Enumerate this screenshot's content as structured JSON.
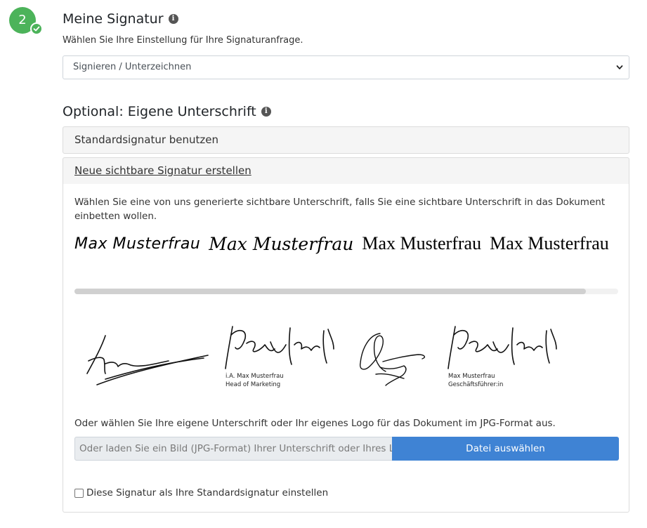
{
  "step": {
    "number": "2",
    "status": "completed"
  },
  "my_signature": {
    "title": "Meine Signatur",
    "subtitle": "Wählen Sie Ihre Einstellung für Ihre Signaturanfrage.",
    "select_value": "Signieren / Unterzeichnen"
  },
  "optional": {
    "title": "Optional: Eigene Unterschrift",
    "standard_panel_label": "Standardsignatur benutzen",
    "new_panel_label": "Neue sichtbare Signatur erstellen",
    "description": "Wählen Sie eine von uns generierte sichtbare Unterschrift, falls Sie eine sichtbare Unterschrift in das Dokument einbetten wollen.",
    "generated_signatures": [
      "Max Musterfrau",
      "Max Musterfrau",
      "Max Musterfrau",
      "Max Musterfrau"
    ],
    "scroll_position": 0.94,
    "handwritten_samples": [
      {
        "caption_line1": "",
        "caption_line2": ""
      },
      {
        "caption_line1": "i.A. Max Musterfrau",
        "caption_line2": "Head of Marketing"
      },
      {
        "caption_line1": "",
        "caption_line2": ""
      },
      {
        "caption_line1": "Max Musterfrau",
        "caption_line2": "Geschäftsführer:in"
      }
    ],
    "upload_text": "Oder wählen Sie Ihre eigene Unterschrift oder Ihr eigenes Logo für das Dokument im JPG-Format aus.",
    "upload_placeholder": "Oder laden Sie ein Bild (JPG-Format) Ihrer Unterschrift oder Ihres Logos hoch",
    "upload_button_label": "Datei auswählen",
    "default_checkbox_label": "Diese Signatur als Ihre Standardsignatur einstellen",
    "default_checkbox_checked": false
  },
  "colors": {
    "success": "#4cb35a",
    "primary": "#3f83d4",
    "panel_bg": "#f5f5f5"
  },
  "icons": [
    "check-icon",
    "info-icon",
    "chevron-down-icon"
  ]
}
